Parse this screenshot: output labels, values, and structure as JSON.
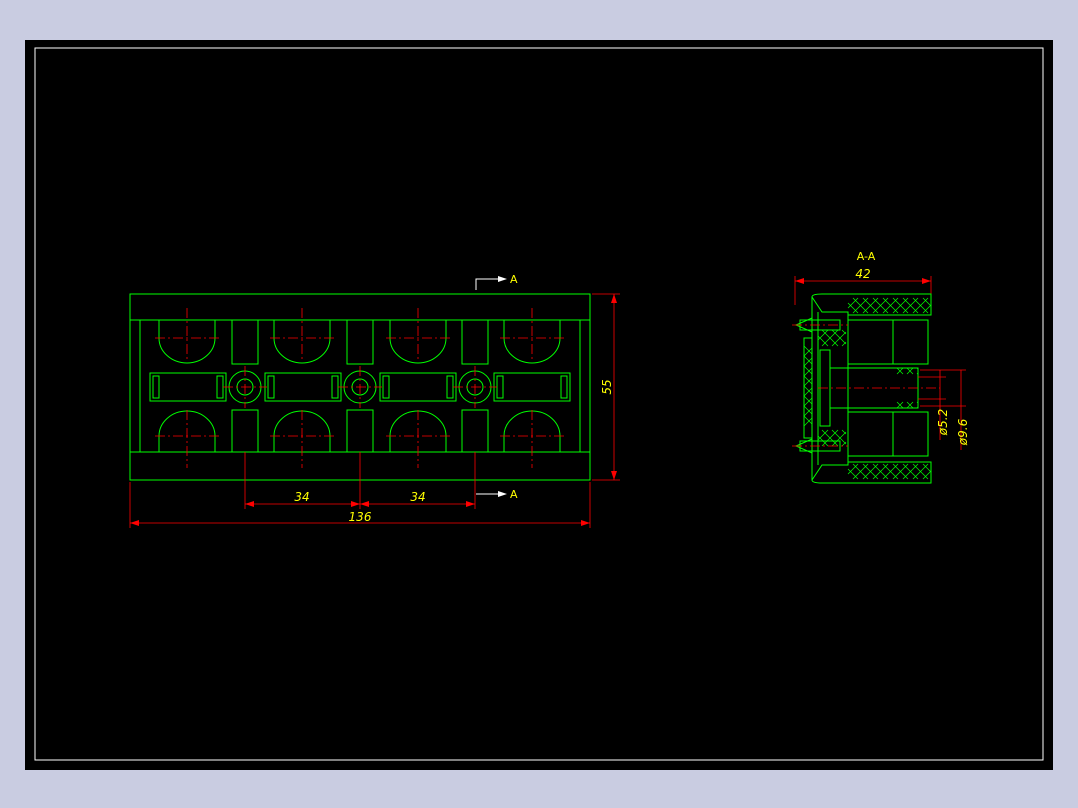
{
  "drawing": {
    "section_label": "A-A",
    "cut_labels": [
      "A",
      "A"
    ],
    "front_view": {
      "dimensions": {
        "pitch_left": "34",
        "pitch_right": "34",
        "overall_width": "136",
        "height": "55"
      }
    },
    "section_view": {
      "dimensions": {
        "width": "42",
        "inner_diameter": "ø5.2",
        "outer_diameter": "ø9.6"
      }
    }
  },
  "colors": {
    "background": "#c9cce1",
    "sheet": "#000000",
    "border": "#ffffff",
    "outline": "#00ff00",
    "centerline": "#ff0000",
    "dimension_text": "#ffff00"
  }
}
